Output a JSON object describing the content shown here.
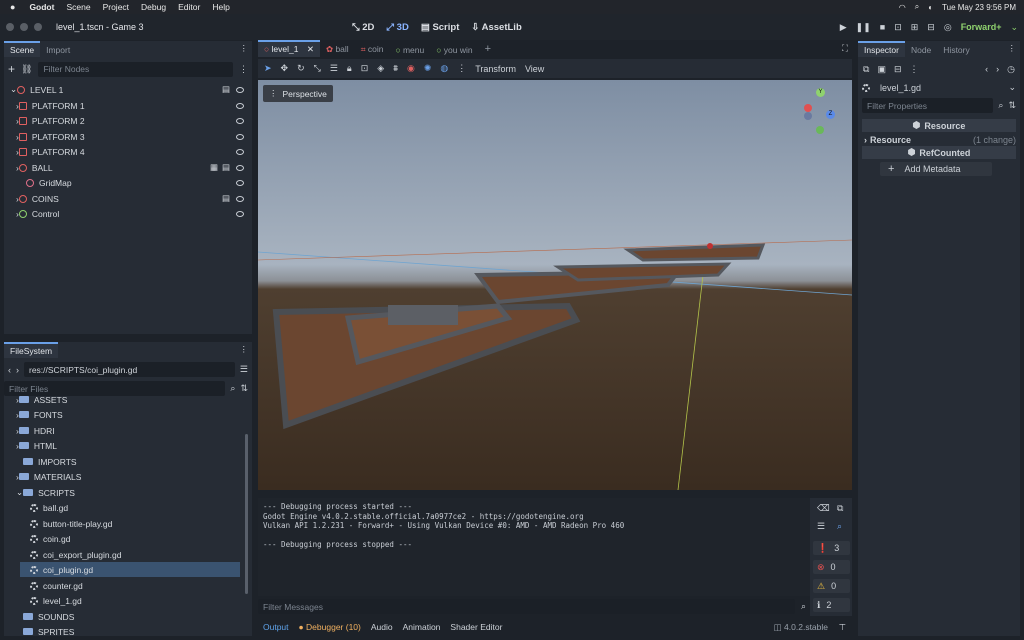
{
  "menubar": {
    "app": "Godot",
    "items": [
      "Scene",
      "Project",
      "Debug",
      "Editor",
      "Help"
    ],
    "clock": "Tue May 23  9:56 PM"
  },
  "window": {
    "title": "level_1.tscn - Game 3",
    "modes": [
      "2D",
      "3D",
      "Script",
      "AssetLib"
    ],
    "renderer": "Forward+"
  },
  "scene_dock": {
    "tabs": [
      "Scene",
      "Import"
    ],
    "filter_placeholder": "Filter Nodes",
    "nodes": [
      "LEVEL 1",
      "PLATFORM 1",
      "PLATFORM 2",
      "PLATFORM 3",
      "PLATFORM 4",
      "BALL",
      "GridMap",
      "COINS",
      "Control"
    ]
  },
  "filesystem": {
    "tab": "FileSystem",
    "path": "res://SCRIPTS/coi_plugin.gd",
    "filter_placeholder": "Filter Files",
    "folders": [
      "ASSETS",
      "FONTS",
      "HDRI",
      "HTML",
      "IMPORTS",
      "MATERIALS",
      "SCRIPTS"
    ],
    "files": [
      "ball.gd",
      "button-title-play.gd",
      "coin.gd",
      "coi_export_plugin.gd",
      "coi_plugin.gd",
      "counter.gd",
      "level_1.gd"
    ],
    "after": [
      "SOUNDS",
      "SPRITES"
    ]
  },
  "editor_tabs": [
    "level_1",
    "ball",
    "coin",
    "menu",
    "you win"
  ],
  "toolbar": {
    "transform": "Transform",
    "view": "View"
  },
  "viewport": {
    "perspective": "Perspective",
    "gizmo": {
      "y": "Y",
      "z": "Z"
    }
  },
  "output": {
    "lines": [
      "--- Debugging process started ---",
      "Godot Engine v4.0.2.stable.official.7a0977ce2 - https://godotengine.org",
      "Vulkan API 1.2.231 - Forward+ - Using Vulkan Device #0: AMD - AMD Radeon Pro 460",
      "",
      "--- Debugging process stopped ---"
    ],
    "filter_placeholder": "Filter Messages",
    "counts": [
      "3",
      "0",
      "0",
      "2"
    ]
  },
  "bottom_tabs": {
    "output": "Output",
    "debugger": "Debugger (10)",
    "audio": "Audio",
    "animation": "Animation",
    "shader": "Shader Editor",
    "version": "4.0.2.stable"
  },
  "inspector": {
    "tabs": [
      "Inspector",
      "Node",
      "History"
    ],
    "resource_name": "level_1.gd",
    "filter_placeholder": "Filter Properties",
    "section_resource": "Resource",
    "resource_label": "Resource",
    "resource_change": "(1 change)",
    "section_ref": "RefCounted",
    "add_meta": "Add Metadata"
  },
  "colors": {
    "accent": "#6aa0e8",
    "panel": "#262c35",
    "output_active": "#5fa3ea",
    "debugger": "#f0b060"
  }
}
